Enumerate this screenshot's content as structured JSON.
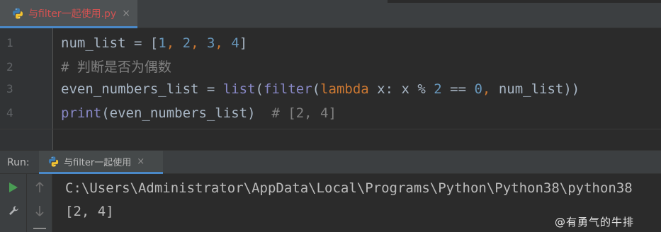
{
  "editor_tab": {
    "filename": "与filter一起使用.py",
    "close_glyph": "×",
    "icon": "python-file-icon",
    "label_color": "#D25252"
  },
  "editor": {
    "line_numbers": [
      "1",
      "2",
      "3",
      "4"
    ],
    "lines": [
      [
        {
          "t": "num_list = [",
          "c": "t-txt"
        },
        {
          "t": "1",
          "c": "t-num"
        },
        {
          "t": ", ",
          "c": "t-punc"
        },
        {
          "t": "2",
          "c": "t-num"
        },
        {
          "t": ", ",
          "c": "t-punc"
        },
        {
          "t": "3",
          "c": "t-num"
        },
        {
          "t": ", ",
          "c": "t-punc"
        },
        {
          "t": "4",
          "c": "t-num"
        },
        {
          "t": "]",
          "c": "t-txt"
        }
      ],
      [
        {
          "t": "# 判断是否为偶数",
          "c": "t-cmt"
        }
      ],
      [
        {
          "t": "even_numbers_list = ",
          "c": "t-txt"
        },
        {
          "t": "list",
          "c": "t-builtin"
        },
        {
          "t": "(",
          "c": "t-txt"
        },
        {
          "t": "filter",
          "c": "t-builtin"
        },
        {
          "t": "(",
          "c": "t-txt"
        },
        {
          "t": "lambda",
          "c": "t-kw"
        },
        {
          "t": " x: x % ",
          "c": "t-txt"
        },
        {
          "t": "2",
          "c": "t-num"
        },
        {
          "t": " == ",
          "c": "t-txt"
        },
        {
          "t": "0",
          "c": "t-num"
        },
        {
          "t": ", ",
          "c": "t-punc"
        },
        {
          "t": "num_list))",
          "c": "t-txt"
        }
      ],
      [
        {
          "t": "print",
          "c": "t-builtin"
        },
        {
          "t": "(even_numbers_list)  ",
          "c": "t-txt"
        },
        {
          "t": "# [2, 4]",
          "c": "t-cmt"
        }
      ]
    ]
  },
  "run_window": {
    "title": "Run:",
    "tab_label": "与filter一起使用",
    "close_glyph": "×",
    "tools_left": [
      "run-icon",
      "wrench-icon"
    ],
    "tools_right": [
      "arrow-up-icon",
      "arrow-down-icon"
    ],
    "output_lines": [
      "C:\\Users\\Administrator\\AppData\\Local\\Programs\\Python\\Python38\\python38",
      "[2, 4]"
    ]
  },
  "watermark": "@有勇气的牛排",
  "colors": {
    "background": "#2B2B2B",
    "panel": "#3C3F41",
    "accent": "#4A88C7",
    "run_green": "#499C54"
  }
}
